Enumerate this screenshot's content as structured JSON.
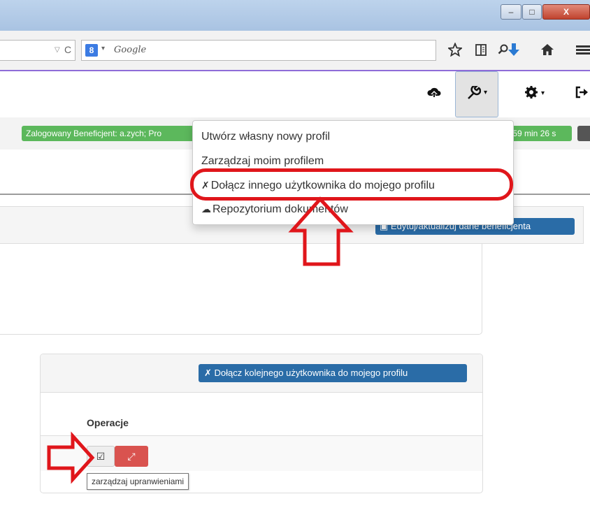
{
  "browser": {
    "window_controls": {
      "minimize": "–",
      "maximize": "□",
      "close": "X"
    },
    "url_dropdown": "▽",
    "reload": "C",
    "search_engine_icon": "8",
    "search_dropdown": "▾",
    "search_placeholder": "Google",
    "toolbar_icons": [
      "search-icon",
      "star-icon",
      "reading-list-icon",
      "download-icon",
      "home-icon",
      "menu-icon"
    ]
  },
  "header": {
    "icons": [
      "cloud-icon",
      "wrench-icon",
      "gear-icon",
      "logout-icon"
    ]
  },
  "status": {
    "user_badge": "Zalogowany Beneficjent: a.zych; Pro",
    "session_badge": "p: 59 min 26 s"
  },
  "dropdown_menu": {
    "items": [
      "Utwórz własny nowy profil",
      "Zarządzaj moim profilem",
      "Dołącz innego użytkownika do mojego profilu",
      "Repozytorium dokumentów"
    ]
  },
  "panel_top": {
    "edit_button": "Edytuj/aktualizuj dane beneficjenta"
  },
  "users_panel": {
    "join_button": "Dołącz kolejnego użytkownika do mojego profilu",
    "column_operacje": "Operacje",
    "tooltip": "zarządzaj upranwieniami"
  },
  "annotation_colors": {
    "highlight": "#e0161b"
  }
}
